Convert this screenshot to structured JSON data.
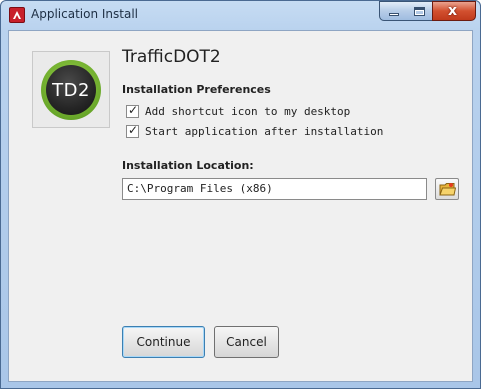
{
  "window": {
    "title": "Application Install",
    "close_glyph": "x"
  },
  "app": {
    "logo_text": "TD2",
    "name": "TrafficDOT2"
  },
  "preferences": {
    "header": "Installation Preferences",
    "options": [
      {
        "label": "Add shortcut icon to my desktop",
        "checked": true
      },
      {
        "label": "Start application after installation",
        "checked": true
      }
    ],
    "check_glyph": "✓"
  },
  "location": {
    "header": "Installation Location:",
    "value": "C:\\Program Files (x86)"
  },
  "buttons": {
    "continue": "Continue",
    "cancel": "Cancel"
  },
  "icons": {
    "app": "adobe-air-icon",
    "browse": "folder-icon",
    "minimize": "minimize-icon",
    "maximize": "maximize-icon",
    "close": "close-icon"
  }
}
